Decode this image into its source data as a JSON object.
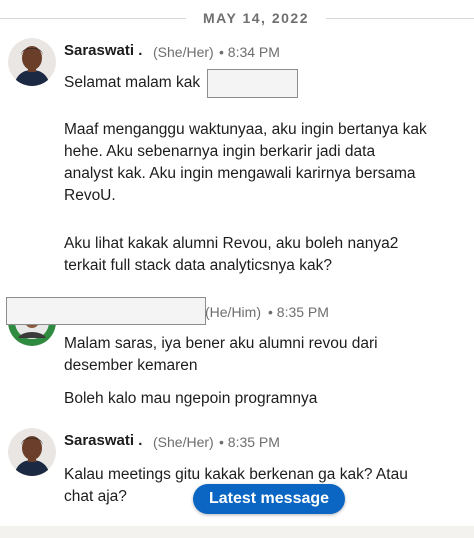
{
  "date_divider": "MAY 14, 2022",
  "messages": [
    {
      "sender": "Saraswati .",
      "pronouns": "(She/Her)",
      "time": "• 8:34 PM",
      "lines": [
        "Selamat malam kak",
        "Maaf menganggu waktunyaa, aku ingin bertanya kak\nhehe. Aku sebenarnya ingin berkarir jadi data\nanalyst kak. Aku ingin mengawali karirnya bersama\nRevoU.",
        "Aku lihat kakak alumni Revou, aku boleh nanya2\nterkait full stack data analyticsnya kak?"
      ]
    },
    {
      "sender": "",
      "pronouns": "(He/Him)",
      "time": "• 8:35 PM",
      "lines": [
        "Malam saras, iya bener aku alumni revou dari\ndesember kemaren",
        "Boleh kalo mau ngepoin programnya"
      ]
    },
    {
      "sender": "Saraswati .",
      "pronouns": "(She/Her)",
      "time": "• 8:35 PM",
      "lines": [
        "Kalau meetings gitu kakak berkenan ga kak? Atau\nchat aja?"
      ]
    }
  ],
  "latest_message_button": "Latest message",
  "colors": {
    "accent": "#0a66c2",
    "meta_text": "#6e6e6e"
  },
  "icons": {
    "avatar_saraswati": "avatar",
    "avatar_other": "avatar"
  }
}
